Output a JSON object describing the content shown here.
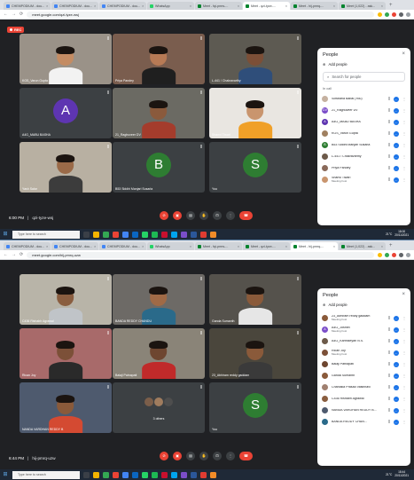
{
  "screens": [
    {
      "tabs": [
        "CHEMPODIUM - dou...",
        "CHEMPODIUM - dou...",
        "CHEMPODIUM - dou...",
        "WhatsApp",
        "Meet - fqi-pmrs-...",
        "Meet - qzi-tyze-...",
        "Meet - hij-pmrq-...",
        "Meet (1,022) - ask..."
      ],
      "active_tab": 5,
      "url": "meet.google.com/qzi-tyze-wsj",
      "time": "6:00 PM",
      "code": "qzi-tyze-wsj",
      "tiles": [
        {
          "name": "KGS_Varun Gupta",
          "kind": "video",
          "bg": "#9a9288",
          "skin": "#c48c63",
          "shirt": "#f2f2f2"
        },
        {
          "name": "Priya Pandey",
          "kind": "video",
          "bg": "#7a5d4e",
          "skin": "#b77a55",
          "shirt": "#1f1f1f"
        },
        {
          "name": "L-441 / Chakravarthy",
          "kind": "video",
          "bg": "#5d5a52",
          "skin": "#7c4f37",
          "shirt": "#2f4e7a"
        },
        {
          "name": "A4G_MABU BASHA",
          "kind": "avatar",
          "letter": "A",
          "color": "#5e35b1"
        },
        {
          "name": "21_Raghuveer DV",
          "kind": "video",
          "bg": "#6b6a63",
          "skin": "#8a5a3c",
          "shirt": "#a43c2c"
        },
        {
          "name": "Shanvi Tiwari",
          "kind": "photo",
          "bg": "#e9e6e1",
          "skin": "#c9956e",
          "shirt": "#f0a028"
        },
        {
          "name": "Yash Salar",
          "kind": "video",
          "bg": "#b8b0a2",
          "skin": "#9a6a48",
          "shirt": "#3c3c3c"
        },
        {
          "name": "B53 Siddhi Manjari Susarla",
          "kind": "avatar",
          "letter": "B",
          "color": "#2e7d32"
        },
        {
          "name": "You",
          "kind": "avatar",
          "letter": "S",
          "color": "#2e7d32"
        }
      ],
      "panel": {
        "title": "People",
        "add": "Add people",
        "search": "Search for people",
        "section": "In call",
        "people": [
          {
            "name": "Sowbaria Babai (You)",
            "sub": "",
            "color": "#c5b1a0",
            "letter": ""
          },
          {
            "name": "21_Raghuveer DV",
            "sub": "",
            "color": "#7b4ec9",
            "letter": "DV"
          },
          {
            "name": "A4G_MABU BASHA",
            "sub": "",
            "color": "#5e35b1",
            "letter": "A"
          },
          {
            "name": "KGS_Varun Gupta",
            "sub": "",
            "color": "#a08060",
            "letter": ""
          },
          {
            "name": "B53 Siddhi Manjari Susarla",
            "sub": "",
            "color": "#2e7d32",
            "letter": "B"
          },
          {
            "name": "L-441 / Chakravarthy",
            "sub": "",
            "color": "#6d5a4a",
            "letter": ""
          },
          {
            "name": "Priya Pandey",
            "sub": "",
            "color": "#8a6a5a",
            "letter": ""
          },
          {
            "name": "Shanvi Tiwari",
            "sub": "Meeting host",
            "color": "#c9956e",
            "letter": ""
          }
        ]
      },
      "tray": {
        "weather": "21°C",
        "clock_time": "18:00",
        "clock_date": "20/11/2021"
      }
    },
    {
      "tabs": [
        "CHEMPODIUM - dou...",
        "CHEMPODIUM - dou...",
        "CHEMPODIUM - dou...",
        "WhatsApp",
        "Meet - fqi-pmrs-...",
        "Meet - qzi-tyze-...",
        "Meet - hij-pmrq-...",
        "Meet (1,022) - ask..."
      ],
      "active_tab": 6,
      "url": "meet.google.com/hij-pmrq-uzw",
      "time": "6:44 PM",
      "code": "hij-pmrq-uzw",
      "tiles": [
        {
          "name": "C436 Rishabh Agrawal",
          "kind": "video",
          "bg": "#b8b4a8",
          "skin": "#8a5e40",
          "shirt": "#c0c4c8"
        },
        {
          "name": "BANDA REDDY CHANDU",
          "kind": "video",
          "bg": "#6d6a66",
          "skin": "#a06a46",
          "shirt": "#2a6a8a"
        },
        {
          "name": "Ganda Sumanth",
          "kind": "video",
          "bg": "#55524c",
          "skin": "#8a5a3a",
          "shirt": "#e6e6e6"
        },
        {
          "name": "Rican Joy",
          "kind": "video",
          "bg": "#a86a6a",
          "skin": "#7c5038",
          "shirt": "#2a2a2a"
        },
        {
          "name": "Balaji Patnapati",
          "kind": "video",
          "bg": "#8a8478",
          "skin": "#6e4630",
          "shirt": "#c02a2a"
        },
        {
          "name": "23_Abhiram reddy gaddam",
          "kind": "video",
          "bg": "#4a463c",
          "skin": "#8a5a3a",
          "shirt": "#3a3a3a"
        },
        {
          "name": "NANDA VARDHAN REDDY B",
          "kind": "video",
          "bg": "#4e5a6e",
          "skin": "#8a5a3a",
          "shirt": "#d44a32"
        },
        {
          "name": "3 others",
          "kind": "others",
          "bg": "#3c4043"
        },
        {
          "name": "You",
          "kind": "avatar",
          "letter": "S",
          "color": "#2e7d32"
        }
      ],
      "panel": {
        "title": "People",
        "add": "Add people",
        "search": "",
        "section": "",
        "people": [
          {
            "name": "23_Abhiram reddy gaddam",
            "sub": "Meeting host",
            "color": "#8a5a3a",
            "letter": ""
          },
          {
            "name": "A4G_Joshith",
            "sub": "Meeting host",
            "color": "#7b4ec9",
            "letter": "A"
          },
          {
            "name": "A4G_Karthikeyan N.S.",
            "sub": "",
            "color": "#6d5a4a",
            "letter": ""
          },
          {
            "name": "Rican Joy",
            "sub": "Meeting host",
            "color": "#7c5038",
            "letter": ""
          },
          {
            "name": "Balaji Patnapati",
            "sub": "",
            "color": "#6e4630",
            "letter": ""
          },
          {
            "name": "Ganda Sumanth",
            "sub": "",
            "color": "#8a5a3a",
            "letter": ""
          },
          {
            "name": "Chandika Prasad Vaishnavi",
            "sub": "",
            "color": "#a08070",
            "letter": ""
          },
          {
            "name": "C436 Rishabh Agrawal",
            "sub": "",
            "color": "#8a5e40",
            "letter": ""
          },
          {
            "name": "NANDA VARDHAN REDDY B...",
            "sub": "",
            "color": "#4e5a6e",
            "letter": ""
          },
          {
            "name": "BANDA REDDY CHAN...",
            "sub": "",
            "color": "#2a6a8a",
            "letter": ""
          }
        ]
      },
      "tray": {
        "weather": "21°C",
        "clock_time": "18:44",
        "clock_date": "20/11/2021"
      }
    }
  ],
  "common": {
    "rec": "REC",
    "taskbar_search": "Type here to search",
    "hangup_icon": "call-end-icon",
    "colors": {
      "meet_bg": "#202124",
      "tile_bg": "#3c4043",
      "accent_red": "#ea4335",
      "accent_blue": "#1a73e8"
    }
  }
}
